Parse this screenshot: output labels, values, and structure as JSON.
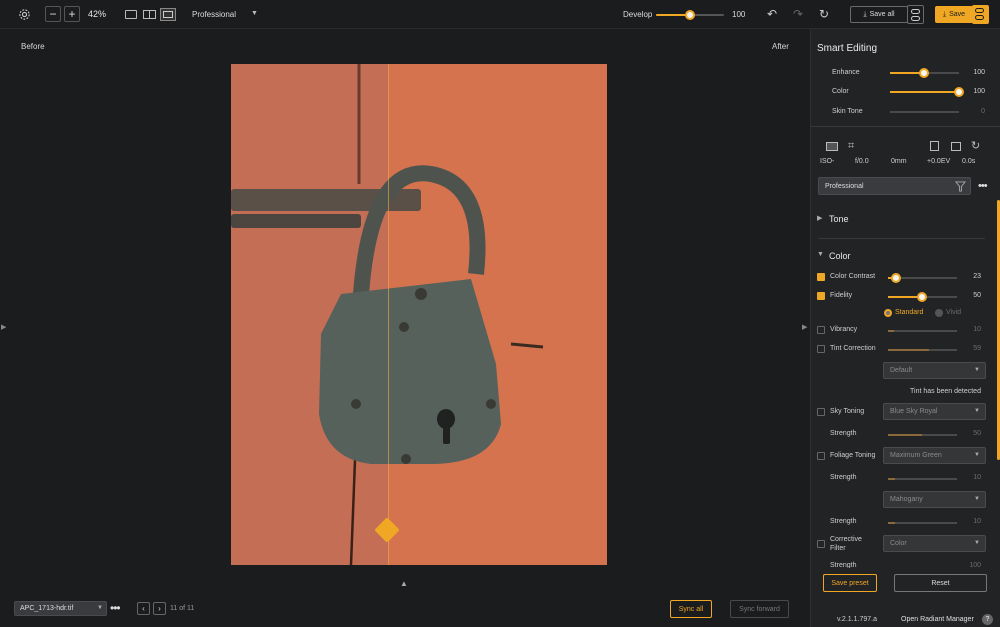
{
  "toolbar": {
    "zoom": "42%",
    "preset": "Professional",
    "develop_label": "Develop",
    "develop_value": "100",
    "develop_level": 0.5,
    "save_all_label": "Save all",
    "save_label": "Save"
  },
  "canvas": {
    "before_label": "Before",
    "after_label": "After"
  },
  "bottom": {
    "file_name": "APC_1713-hdr.tif",
    "counter": "11 of 11",
    "sync_all": "Sync all",
    "sync_forward": "Sync forward"
  },
  "panel": {
    "title": "Smart Editing",
    "enhance": {
      "label": "Enhance",
      "value": "100",
      "level": 0.5
    },
    "color": {
      "label": "Color",
      "value": "100",
      "level": 1.0
    },
    "skin_tone": {
      "label": "Skin Tone",
      "value": "0",
      "level": 0
    },
    "exif": {
      "iso": "ISO-",
      "aperture": "f/0.0",
      "focal": "0mm",
      "ev": "+0.0EV",
      "shutter": "0.0s"
    },
    "preset": "Professional",
    "tone_label": "Tone",
    "color_section_label": "Color",
    "color_contrast": {
      "label": "Color Contrast",
      "value": "23",
      "level": 0.1
    },
    "fidelity": {
      "label": "Fidelity",
      "value": "50",
      "level": 0.5
    },
    "mode_standard": "Standard",
    "mode_vivid": "Vivid",
    "vibrancy": {
      "label": "Vibrancy",
      "value": "10",
      "level": 0.08
    },
    "tint_correction": {
      "label": "Tint Correction",
      "value": "59",
      "level": 0.59
    },
    "tint_default": "Default",
    "tint_detected": "Tint has been detected",
    "sky_toning": {
      "label": "Sky Toning",
      "option": "Blue Sky Royal"
    },
    "sky_strength": {
      "label": "Strength",
      "value": "50",
      "level": 0.5
    },
    "foliage_toning": {
      "label": "Foliage Toning",
      "option": "Maximum Green"
    },
    "foliage_strength": {
      "label": "Strength",
      "value": "10",
      "level": 0.1
    },
    "mahogany": {
      "option": "Mahogany"
    },
    "mahogany_strength": {
      "label": "Strength",
      "value": "10",
      "level": 0.1
    },
    "corrective_filter": {
      "label_line1": "Corrective",
      "label_line2": "Filter",
      "option": "Color"
    },
    "cut_strength": {
      "label": "Strength",
      "value": "100"
    },
    "save_preset": "Save preset",
    "reset": "Reset",
    "version": "v.2.1.1.797.a",
    "open_manager": "Open Radiant Manager",
    "help_icon": "?"
  },
  "colors": {
    "accent": "#f0a824",
    "background": "#1b1c1e",
    "panel": "#222325"
  }
}
